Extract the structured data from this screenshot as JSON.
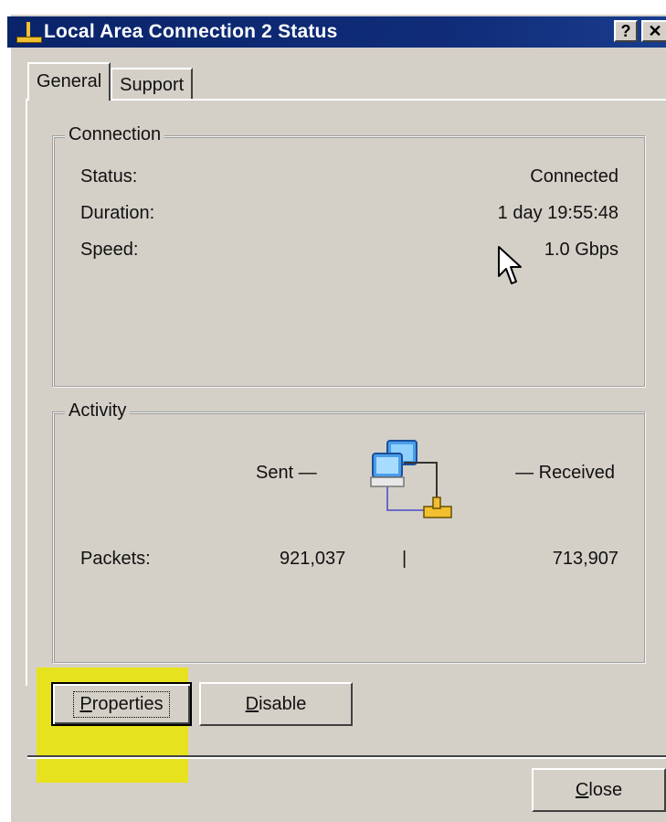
{
  "window": {
    "title": "Local Area Connection 2 Status",
    "help_button": "?",
    "close_glyph": "✕"
  },
  "tabs": [
    {
      "label": "General",
      "active": true
    },
    {
      "label": "Support",
      "active": false
    }
  ],
  "connection": {
    "group_label": "Connection",
    "status_label": "Status:",
    "status_value": "Connected",
    "duration_label": "Duration:",
    "duration_value": "1 day 19:55:48",
    "speed_label": "Speed:",
    "speed_value": "1.0 Gbps"
  },
  "activity": {
    "group_label": "Activity",
    "sent_label": "Sent —",
    "received_label": "— Received",
    "packets_label": "Packets:",
    "packets_sent": "921,037",
    "packets_divider": "|",
    "packets_received": "713,907",
    "icon": "network-computers-icon"
  },
  "buttons": {
    "properties_first": "P",
    "properties_rest": "roperties",
    "disable_first": "D",
    "disable_rest": "isable",
    "close_first": "C",
    "close_rest": "lose"
  },
  "colors": {
    "titlebar": "#0a246a",
    "dialog_bg": "#d4d0c8",
    "highlight": "#e6e21d"
  }
}
